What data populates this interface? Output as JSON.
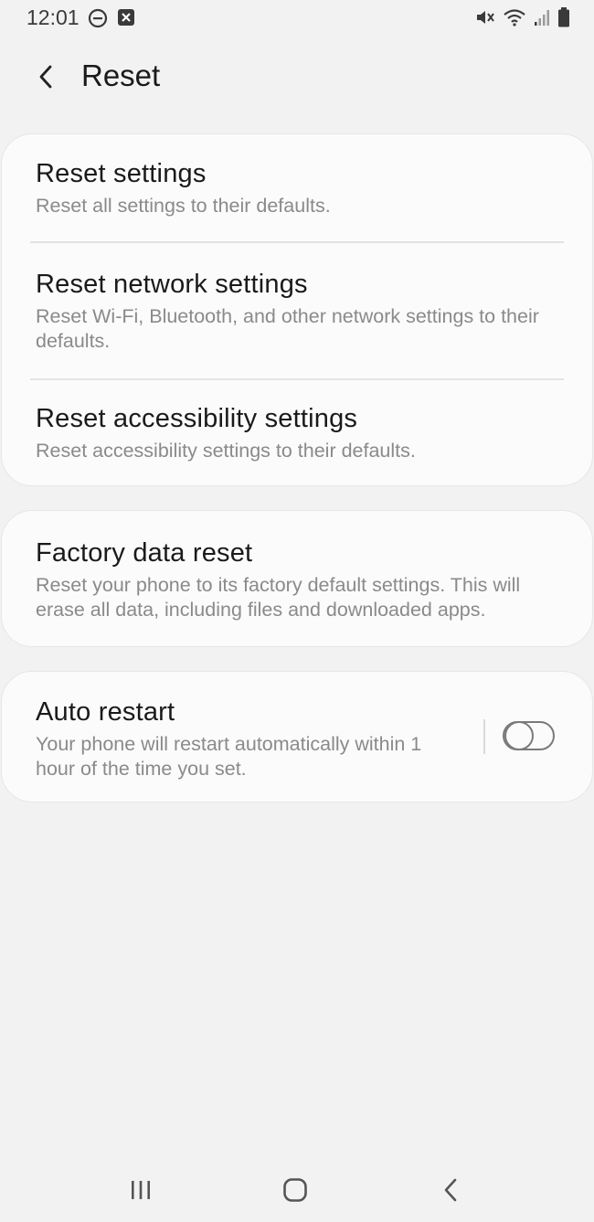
{
  "status_bar": {
    "time": "12:01",
    "icons": [
      "do-not-disturb-icon",
      "notification-icon",
      "mute-icon",
      "wifi-icon",
      "signal-icon",
      "battery-icon"
    ]
  },
  "header": {
    "title": "Reset",
    "back_icon": "back-arrow-icon"
  },
  "reset_group": {
    "items": [
      {
        "title": "Reset settings",
        "subtitle": "Reset all settings to their defaults."
      },
      {
        "title": "Reset network settings",
        "subtitle": "Reset Wi-Fi, Bluetooth, and other network settings to their defaults."
      },
      {
        "title": "Reset accessibility settings",
        "subtitle": "Reset accessibility settings to their defaults."
      }
    ]
  },
  "factory_reset": {
    "title": "Factory data reset",
    "subtitle": "Reset your phone to its factory default settings. This will erase all data, including files and downloaded apps."
  },
  "auto_restart": {
    "title": "Auto restart",
    "subtitle": "Your phone will restart automatically within 1 hour of the time you set.",
    "enabled": false
  },
  "nav_bar": {
    "buttons": [
      "recent-apps-icon",
      "home-icon",
      "nav-back-icon"
    ]
  },
  "colors": {
    "background": "#f2f2f2",
    "card": "#fbfbfb",
    "title_text": "#1a1a1a",
    "subtitle_text": "#8a8a8a"
  }
}
